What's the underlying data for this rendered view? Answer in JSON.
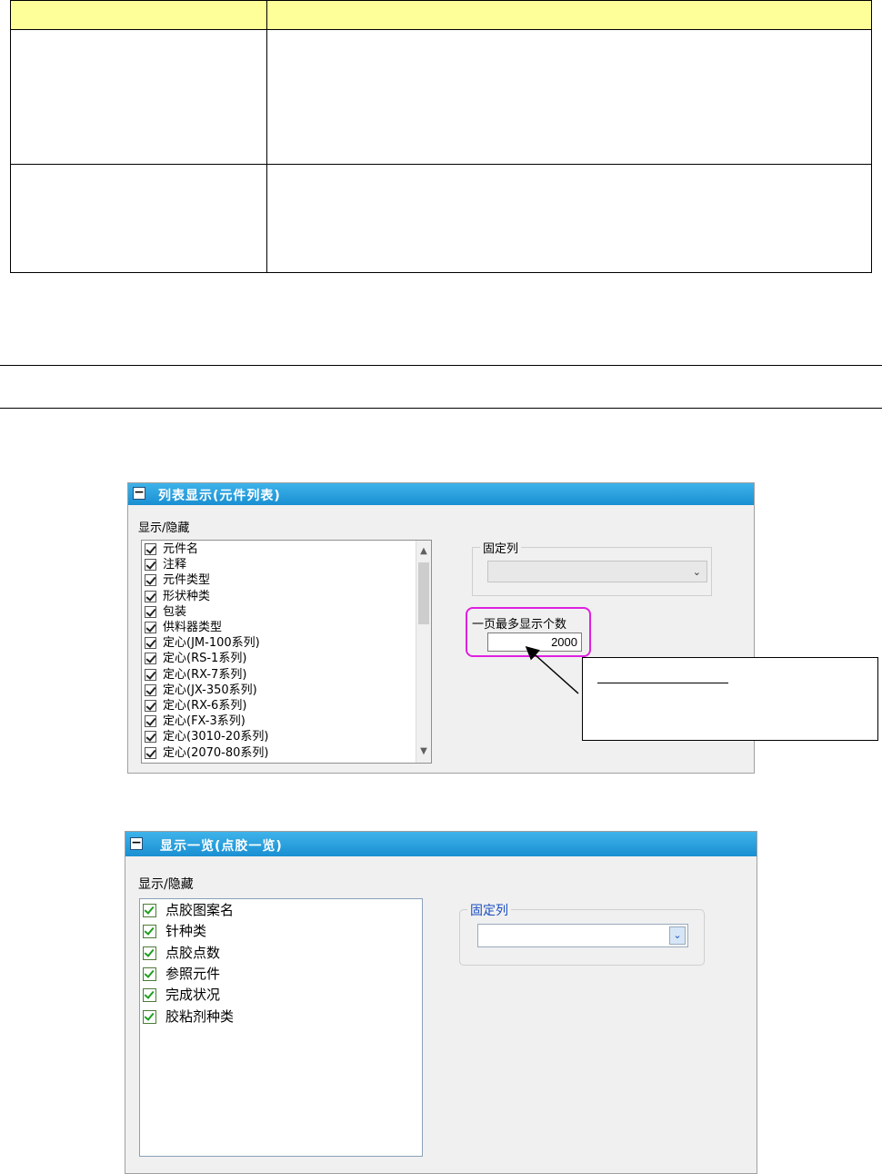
{
  "panel1": {
    "title": "列表显示(元件列表)",
    "collapse_glyph": "−",
    "show_hide_label": "显示/隐藏",
    "items": [
      "元件名",
      "注释",
      "元件类型",
      "形状种类",
      "包装",
      "供料器类型",
      "定心(JM-100系列)",
      "定心(RS-1系列)",
      "定心(RX-7系列)",
      "定心(JX-350系列)",
      "定心(RX-6系列)",
      "定心(FX-3系列)",
      "定心(3010-20系列)",
      "定心(2070-80系列)"
    ],
    "fixed_column_label": "固定列",
    "fixed_column_value": "",
    "max_per_page_label": "一页最多显示个数",
    "max_per_page_value": "2000"
  },
  "panel2": {
    "title": "显示一览(点胶一览)",
    "collapse_glyph": "−",
    "show_hide_label": "显示/隐藏",
    "items": [
      "点胶图案名",
      "针种类",
      "点胶点数",
      "参照元件",
      "完成状况",
      "胶粘剂种类"
    ],
    "fixed_column_label": "固定列",
    "fixed_column_value": ""
  },
  "icons": {
    "collapse": "minus-box-icon",
    "scroll_up": "chevron-up-icon",
    "scroll_down": "chevron-down-icon",
    "dropdown": "chevron-down-icon",
    "checkbox": "check-icon"
  },
  "colors": {
    "table_header": "#ffff99",
    "panel_bar": "#1a8fd2",
    "highlight": "#e020e0"
  }
}
